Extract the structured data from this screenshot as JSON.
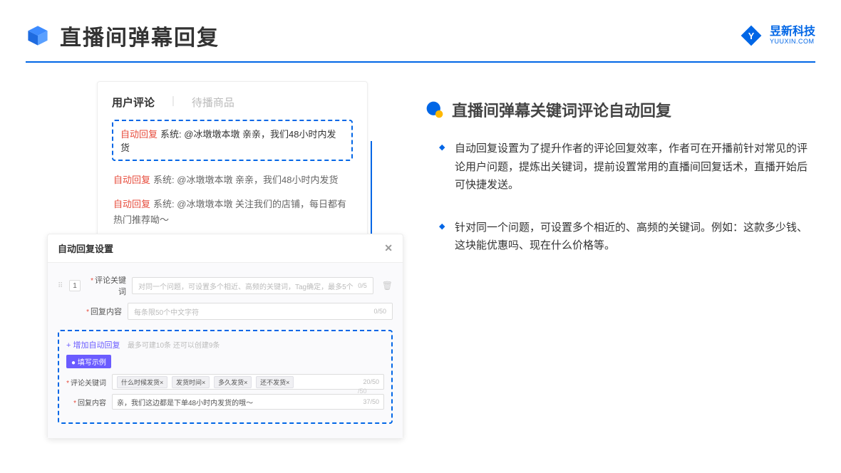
{
  "header": {
    "title": "直播间弹幕回复",
    "logo_cn": "昱新科技",
    "logo_en": "YUUXIN.COM"
  },
  "comment_card": {
    "tab_active": "用户评论",
    "tab_inactive": "待播商品",
    "highlighted": {
      "label": "自动回复",
      "prefix": "系统:",
      "text": " @冰墩墩本墩 亲亲，我们48小时内发货"
    },
    "items": [
      {
        "label": "自动回复",
        "prefix": "系统:",
        "text": " @冰墩墩本墩 亲亲，我们48小时内发货"
      },
      {
        "label": "自动回复",
        "prefix": "系统:",
        "text": " @冰墩墩本墩 关注我们的店铺，每日都有热门推荐呦～"
      }
    ]
  },
  "settings": {
    "title": "自动回复设置",
    "close": "✕",
    "row1": {
      "num": "1",
      "star": "*",
      "keyword_label": "评论关键词",
      "keyword_placeholder": "对同一个问题，可设置多个相近、高频的关键词，Tag确定，最多5个",
      "keyword_count": "0/5",
      "content_label": "回复内容",
      "content_placeholder": "每条限50个中文字符",
      "content_count": "0/50"
    },
    "example": {
      "add_text": "+ 增加自动回复",
      "add_hint": "最多可建10条 还可以创建9条",
      "badge": "● 填写示例",
      "keyword_label": "评论关键词",
      "tags": [
        "什么时候发货×",
        "发货时间×",
        "多久发货×",
        "还不发货×"
      ],
      "keyword_count": "20/50",
      "content_label": "回复内容",
      "content_text": "亲，我们这边都是下单48小时内发货的哦～",
      "content_count": "37/50"
    },
    "faint_50": "/50"
  },
  "right": {
    "section_title": "直播间弹幕关键词评论自动回复",
    "bullets": [
      "自动回复设置为了提升作者的评论回复效率，作者可在开播前针对常见的评论用户问题，提炼出关键词，提前设置常用的直播间回复话术，直播开始后可快捷发送。",
      "针对同一个问题，可设置多个相近的、高频的关键词。例如：这款多少钱、这块能优惠吗、现在什么价格等。"
    ]
  }
}
